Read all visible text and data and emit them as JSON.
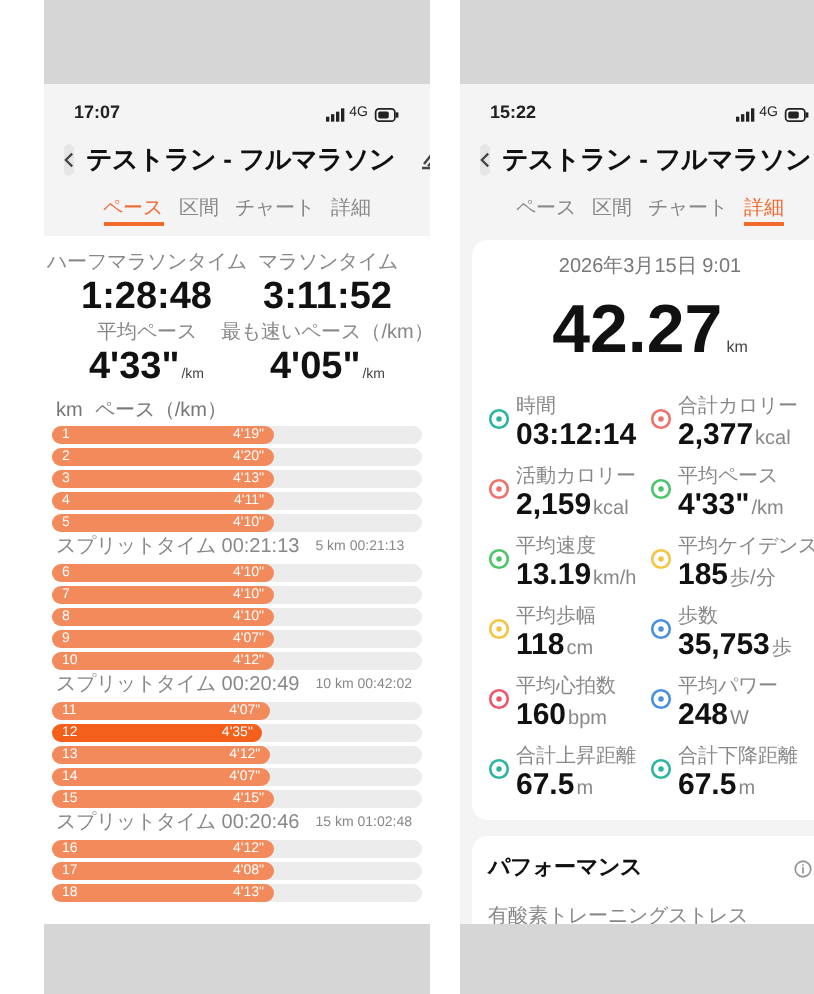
{
  "screens": [
    {
      "kind": "pace",
      "status_bar": {
        "time": "17:07",
        "network": "4G"
      },
      "title": "テストラン - フルマラソン",
      "tabs": [
        {
          "label": "ペース",
          "selected": true
        },
        {
          "label": "区間",
          "selected": false
        },
        {
          "label": "チャート",
          "selected": false
        },
        {
          "label": "詳細",
          "selected": false
        }
      ],
      "summary": [
        {
          "label": "ハーフマラソンタイム",
          "value": "1:28:48"
        },
        {
          "label": "マラソンタイム",
          "value": "3:11:52"
        },
        {
          "label": "平均ペース",
          "value": "4'33\"",
          "unit": "/km"
        },
        {
          "label": "最も速いペース（/km）",
          "value": "4'05\"",
          "unit": "/km"
        }
      ],
      "pace_list": {
        "header": [
          "km",
          "ペース（/km）"
        ],
        "rows": [
          {
            "kind": "lap",
            "km": "1",
            "pace": "4'19\"",
            "level": 0.6,
            "highlighted": false
          },
          {
            "kind": "lap",
            "km": "2",
            "pace": "4'20\"",
            "level": 0.6,
            "highlighted": false
          },
          {
            "kind": "lap",
            "km": "3",
            "pace": "4'13\"",
            "level": 0.6,
            "highlighted": false
          },
          {
            "kind": "lap",
            "km": "4",
            "pace": "4'11\"",
            "level": 0.6,
            "highlighted": false
          },
          {
            "kind": "lap",
            "km": "5",
            "pace": "4'10\"",
            "level": 0.6,
            "highlighted": false
          },
          {
            "kind": "split",
            "label": "スプリットタイム 00:21:13",
            "total": "5 km 00:21:13"
          },
          {
            "kind": "lap",
            "km": "6",
            "pace": "4'10\"",
            "level": 0.6,
            "highlighted": false
          },
          {
            "kind": "lap",
            "km": "7",
            "pace": "4'10\"",
            "level": 0.6,
            "highlighted": false
          },
          {
            "kind": "lap",
            "km": "8",
            "pace": "4'10\"",
            "level": 0.6,
            "highlighted": false
          },
          {
            "kind": "lap",
            "km": "9",
            "pace": "4'07\"",
            "level": 0.6,
            "highlighted": false
          },
          {
            "kind": "lap",
            "km": "10",
            "pace": "4'12\"",
            "level": 0.6,
            "highlighted": false
          },
          {
            "kind": "split",
            "label": "スプリットタイム 00:20:49",
            "total": "10 km 00:42:02"
          },
          {
            "kind": "lap",
            "km": "11",
            "pace": "4'07\"",
            "level": 0.59,
            "highlighted": false
          },
          {
            "kind": "lap",
            "km": "12",
            "pace": "4'35\"",
            "level": 0.57,
            "highlighted": true
          },
          {
            "kind": "lap",
            "km": "13",
            "pace": "4'12\"",
            "level": 0.59,
            "highlighted": false
          },
          {
            "kind": "lap",
            "km": "14",
            "pace": "4'07\"",
            "level": 0.59,
            "highlighted": false
          },
          {
            "kind": "lap",
            "km": "15",
            "pace": "4'15\"",
            "level": 0.6,
            "highlighted": false
          },
          {
            "kind": "split",
            "label": "スプリットタイム 00:20:46",
            "total": "15 km 01:02:48"
          },
          {
            "kind": "lap",
            "km": "16",
            "pace": "4'12\"",
            "level": 0.6,
            "highlighted": false
          },
          {
            "kind": "lap",
            "km": "17",
            "pace": "4'08\"",
            "level": 0.6,
            "highlighted": false
          },
          {
            "kind": "lap",
            "km": "18",
            "pace": "4'13\"",
            "level": 0.6,
            "highlighted": false
          }
        ]
      }
    },
    {
      "kind": "details",
      "status_bar": {
        "time": "15:22",
        "network": "4G"
      },
      "title": "テストラン - フルマラソン",
      "tabs": [
        {
          "label": "ペース",
          "selected": false
        },
        {
          "label": "区間",
          "selected": false
        },
        {
          "label": "チャート",
          "selected": false
        },
        {
          "label": "詳細",
          "selected": true
        }
      ],
      "date": "2026年3月15日 9:01",
      "distance": {
        "value": "42.27",
        "unit": "km"
      },
      "metrics": [
        {
          "label": "時間",
          "value": "03:12:14",
          "color": "#2bb5a0"
        },
        {
          "label": "合計カロリー",
          "value": "2,377",
          "unit": "kcal",
          "color": "#f0706a"
        },
        {
          "label": "活動カロリー",
          "value": "2,159",
          "unit": "kcal",
          "color": "#f0706a"
        },
        {
          "label": "平均ペース",
          "value": "4'33\"",
          "unit": "/km",
          "color": "#4cc46a"
        },
        {
          "label": "平均速度",
          "value": "13.19",
          "unit": "km/h",
          "color": "#4cc46a"
        },
        {
          "label": "平均ケイデンス",
          "value": "185",
          "unit": "歩/分",
          "color": "#f5c342"
        },
        {
          "label": "平均歩幅",
          "value": "118",
          "unit": "cm",
          "color": "#f5c342"
        },
        {
          "label": "歩数",
          "value": "35,753",
          "unit": "歩",
          "color": "#4a8fe0"
        },
        {
          "label": "平均心拍数",
          "value": "160",
          "unit": "bpm",
          "color": "#f0566a"
        },
        {
          "label": "平均パワー",
          "value": "248",
          "unit": "W",
          "color": "#4a8fe0"
        },
        {
          "label": "合計上昇距離",
          "value": "67.5",
          "unit": "m",
          "color": "#2bb5a0"
        },
        {
          "label": "合計下降距離",
          "value": "67.5",
          "unit": "m",
          "color": "#2bb5a0"
        }
      ],
      "performance": {
        "title": "パフォーマンス",
        "subtitle": "有酸素トレーニングストレス"
      }
    }
  ]
}
